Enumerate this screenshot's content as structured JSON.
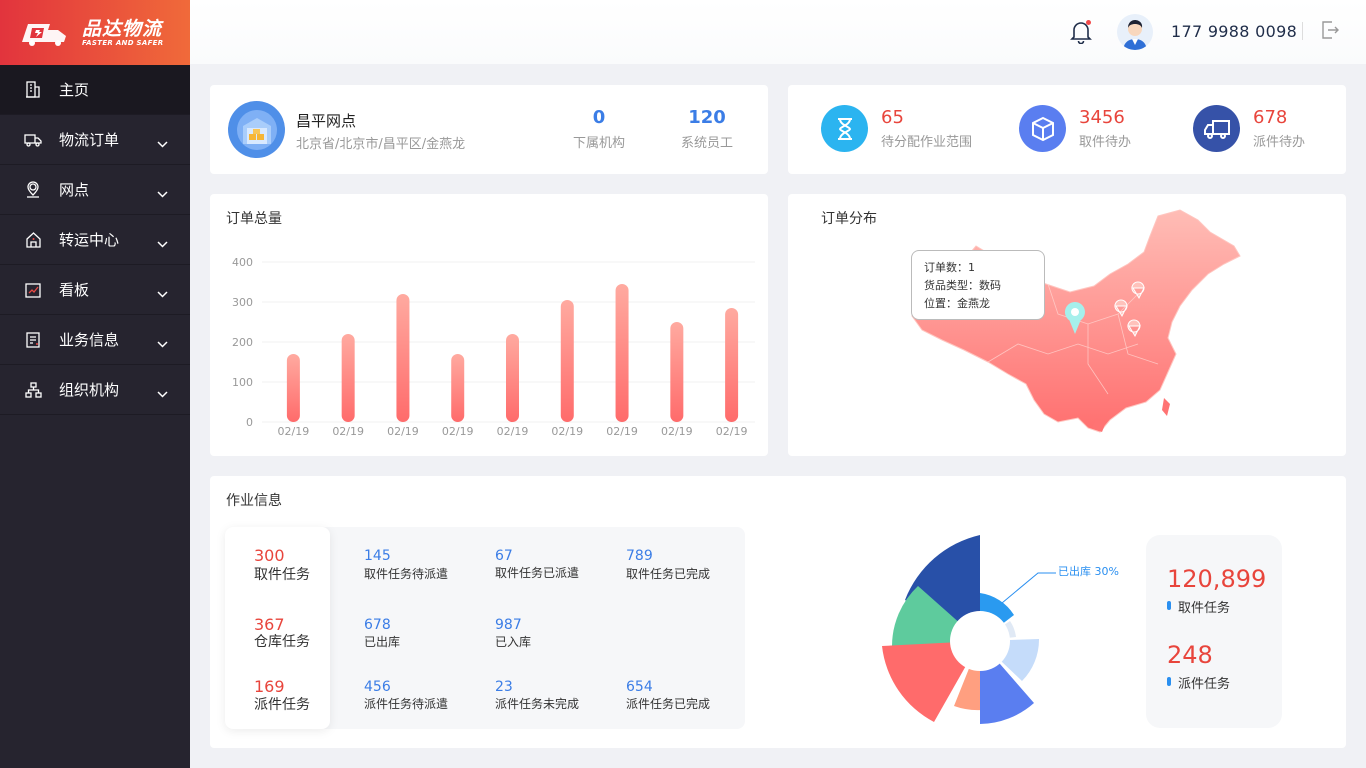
{
  "app": {
    "name_cn": "品达物流",
    "name_en": "FASTER AND SAFER"
  },
  "sidebar": {
    "items": [
      {
        "label": "主页",
        "icon": "building-icon"
      },
      {
        "label": "物流订单",
        "icon": "truck-icon"
      },
      {
        "label": "网点",
        "icon": "location-pin-icon"
      },
      {
        "label": "转运中心",
        "icon": "home-icon"
      },
      {
        "label": "看板",
        "icon": "chart-line-icon"
      },
      {
        "label": "业务信息",
        "icon": "document-icon"
      },
      {
        "label": "组织机构",
        "icon": "org-tree-icon"
      }
    ]
  },
  "header": {
    "phone": "177 9988 0098"
  },
  "site": {
    "name": "昌平网点",
    "address": "北京省/北京市/昌平区/金燕龙",
    "sub_orgs_value": "0",
    "sub_orgs_label": "下属机构",
    "staff_value": "120",
    "staff_label": "系统员工"
  },
  "todos": [
    {
      "value": "65",
      "label": "待分配作业范围",
      "icon": "hourglass-icon",
      "color": "#2bb4f0"
    },
    {
      "value": "3456",
      "label": "取件待办",
      "icon": "box-icon",
      "color": "#5a7ef0"
    },
    {
      "value": "678",
      "label": "派件待办",
      "icon": "van-icon",
      "color": "#3652a8"
    }
  ],
  "order_total": {
    "title": "订单总量"
  },
  "chart_data": {
    "type": "bar",
    "categories": [
      "02/19",
      "02/19",
      "02/19",
      "02/19",
      "02/19",
      "02/19",
      "02/19",
      "02/19",
      "02/19"
    ],
    "values": [
      170,
      220,
      320,
      170,
      220,
      305,
      345,
      250,
      285
    ],
    "ylim": [
      0,
      400
    ],
    "yticks": [
      "400",
      "300",
      "200",
      "100",
      "0"
    ],
    "color_top": "#ffaaa0",
    "color_bottom": "#ff6b6b"
  },
  "order_dist": {
    "title": "订单分布",
    "tooltip": {
      "line1": "订单数：1",
      "line2": "货品类型：数码",
      "line3": "位置：金燕龙"
    }
  },
  "ops": {
    "title": "作业信息",
    "groups": [
      {
        "value": "300",
        "label": "取件任务",
        "stats": [
          {
            "value": "145",
            "label": "取件任务待派遣"
          },
          {
            "value": "67",
            "label": "取件任务已派遣"
          },
          {
            "value": "789",
            "label": "取件任务已完成"
          }
        ]
      },
      {
        "value": "367",
        "label": "仓库任务",
        "stats": [
          {
            "value": "678",
            "label": "已出库"
          },
          {
            "value": "987",
            "label": "已入库"
          }
        ]
      },
      {
        "value": "169",
        "label": "派件任务",
        "stats": [
          {
            "value": "456",
            "label": "派件任务待派遣"
          },
          {
            "value": "23",
            "label": "派件任务未完成"
          },
          {
            "value": "654",
            "label": "派件任务已完成"
          }
        ]
      }
    ],
    "pie_label": "已出库  30%",
    "summary": [
      {
        "value": "120,899",
        "label": "取件任务"
      },
      {
        "value": "248",
        "label": "派件任务"
      }
    ]
  }
}
